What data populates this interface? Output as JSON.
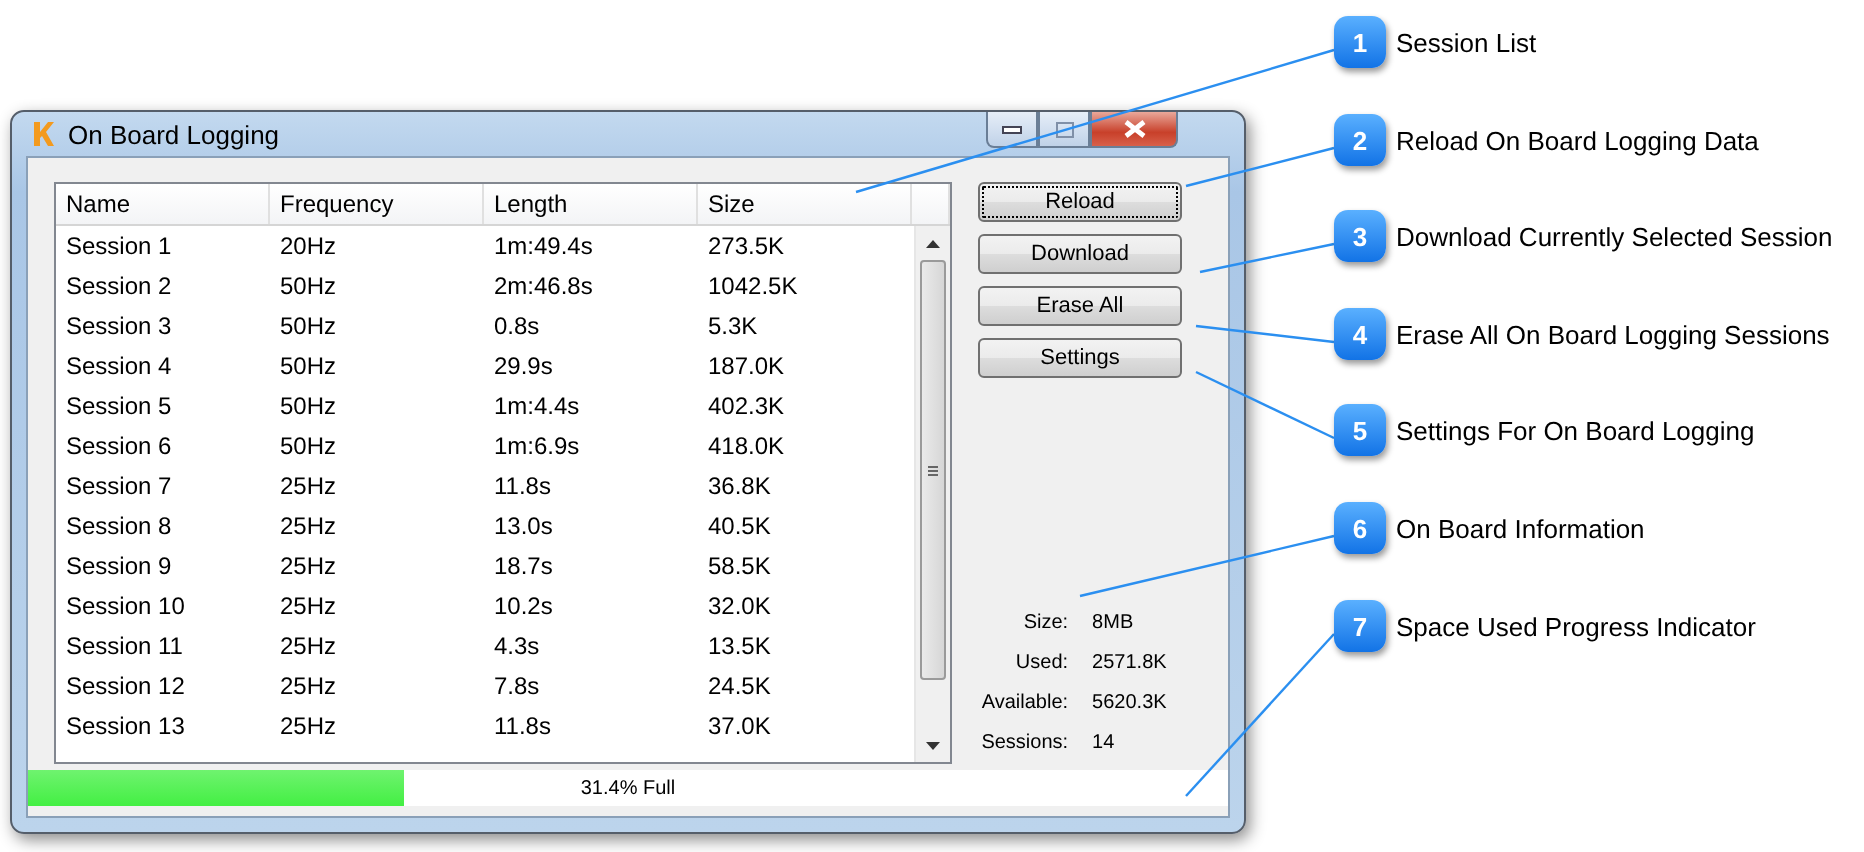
{
  "window": {
    "title": "On Board Logging"
  },
  "table": {
    "columns": [
      "Name",
      "Frequency",
      "Length",
      "Size"
    ],
    "rows": [
      [
        "Session 1",
        "20Hz",
        "1m:49.4s",
        "273.5K"
      ],
      [
        "Session 2",
        "50Hz",
        "2m:46.8s",
        "1042.5K"
      ],
      [
        "Session 3",
        "50Hz",
        "0.8s",
        "5.3K"
      ],
      [
        "Session 4",
        "50Hz",
        "29.9s",
        "187.0K"
      ],
      [
        "Session 5",
        "50Hz",
        "1m:4.4s",
        "402.3K"
      ],
      [
        "Session 6",
        "50Hz",
        "1m:6.9s",
        "418.0K"
      ],
      [
        "Session 7",
        "25Hz",
        "11.8s",
        "36.8K"
      ],
      [
        "Session 8",
        "25Hz",
        "13.0s",
        "40.5K"
      ],
      [
        "Session 9",
        "25Hz",
        "18.7s",
        "58.5K"
      ],
      [
        "Session 10",
        "25Hz",
        "10.2s",
        "32.0K"
      ],
      [
        "Session 11",
        "25Hz",
        "4.3s",
        "13.5K"
      ],
      [
        "Session 12",
        "25Hz",
        "7.8s",
        "24.5K"
      ],
      [
        "Session 13",
        "25Hz",
        "11.8s",
        "37.0K"
      ]
    ]
  },
  "buttons": [
    {
      "label": "Reload",
      "focused": true
    },
    {
      "label": "Download",
      "focused": false
    },
    {
      "label": "Erase All",
      "focused": false
    },
    {
      "label": "Settings",
      "focused": false
    }
  ],
  "info": [
    {
      "label": "Size:",
      "value": "8MB"
    },
    {
      "label": "Used:",
      "value": "2571.8K"
    },
    {
      "label": "Available:",
      "value": "5620.3K"
    },
    {
      "label": "Sessions:",
      "value": "14"
    }
  ],
  "progress": {
    "level": 0.314,
    "label": "31.4% Full"
  },
  "callouts": [
    {
      "number": "1",
      "label": "Session List"
    },
    {
      "number": "2",
      "label": "Reload On Board Logging Data"
    },
    {
      "number": "3",
      "label": "Download Currently Selected Session"
    },
    {
      "number": "4",
      "label": "Erase All On Board Logging Sessions"
    },
    {
      "number": "5",
      "label": "Settings For On Board Logging"
    },
    {
      "number": "6",
      "label": "On Board Information"
    },
    {
      "number": "7",
      "label": "Space Used Progress Indicator"
    }
  ]
}
